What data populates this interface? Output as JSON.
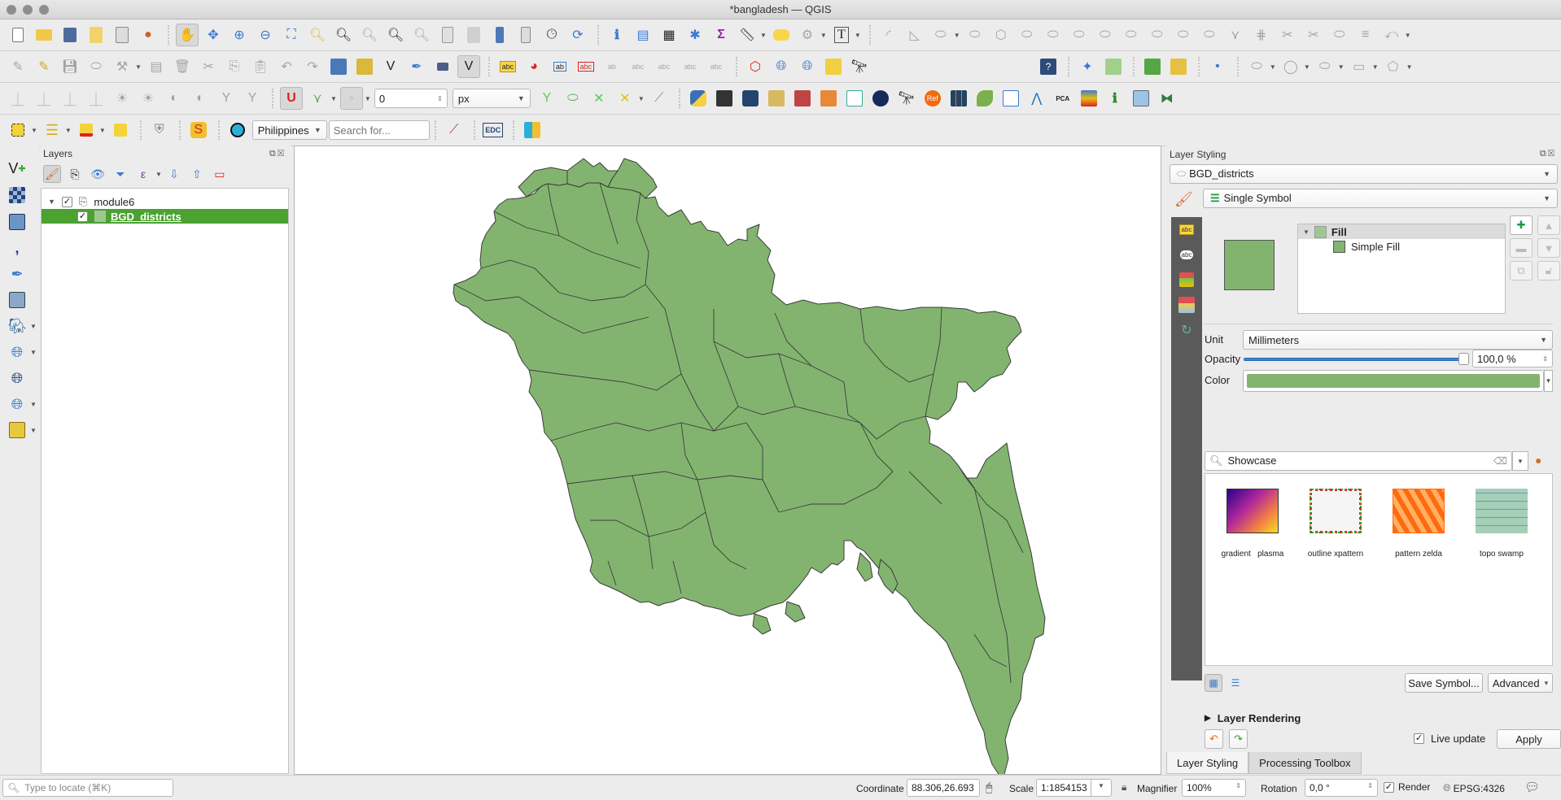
{
  "window": {
    "title": "*bangladesh — QGIS"
  },
  "toolbars": {
    "row1": [
      "new-project",
      "open-project",
      "save-project",
      "new-print-layout",
      "layout-manager",
      "style-manager",
      "pan-map",
      "pan-to-selection",
      "zoom-in",
      "zoom-out",
      "zoom-full",
      "zoom-to-selection",
      "zoom-to-layer",
      "zoom-native",
      "zoom-last",
      "zoom-next",
      "new-bookmark",
      "show-bookmarks",
      "new-spatial-bookmark",
      "temporal-controller",
      "refresh",
      "identify-features",
      "open-attribute-table",
      "open-field-calculator",
      "toolbox",
      "statistical-summary",
      "measure",
      "map-tips",
      "select-by-location",
      "text-annotation"
    ],
    "snapping_tolerance": "0",
    "snapping_unit": "px",
    "locator_country": "Philippines",
    "search_placeholder": "Search for..."
  },
  "layers_panel": {
    "title": "Layers",
    "group": {
      "name": "module6",
      "checked": true,
      "expanded": true
    },
    "layers": [
      {
        "name": "BGD_districts",
        "checked": true,
        "selected": true,
        "swatch_color": "#8cbf7a"
      }
    ]
  },
  "map": {
    "fill_color": "#83b46f",
    "stroke_color": "#3c3c3c",
    "background": "#ffffff"
  },
  "layer_styling": {
    "title": "Layer Styling",
    "layer_select": "BGD_districts",
    "renderer": "Single Symbol",
    "symbol_tree": [
      {
        "label": "Fill",
        "bold": true
      },
      {
        "label": "Simple Fill",
        "bold": false
      }
    ],
    "unit_label": "Unit",
    "unit_value": "Millimeters",
    "opacity_label": "Opacity",
    "opacity_percent": 100,
    "opacity_text": "100,0 %",
    "color_label": "Color",
    "color_value": "#83b46f",
    "search_value": "Showcase",
    "showcase": [
      {
        "label": "gradient   plasma"
      },
      {
        "label": "outline xpattern"
      },
      {
        "label": "pattern zelda"
      },
      {
        "label": "topo swamp"
      }
    ],
    "save_symbol": "Save Symbol...",
    "advanced": "Advanced",
    "layer_rendering": "Layer Rendering",
    "live_update": "Live update",
    "live_update_checked": true,
    "apply": "Apply"
  },
  "dock_tabs": [
    {
      "label": "Layer Styling",
      "active": true
    },
    {
      "label": "Processing Toolbox",
      "active": false
    }
  ],
  "statusbar": {
    "locator_placeholder": "Type to locate (⌘K)",
    "coordinate_label": "Coordinate",
    "coordinate_value": "88.306,26.693",
    "scale_label": "Scale",
    "scale_value": "1:1854153",
    "magnifier_label": "Magnifier",
    "magnifier_value": "100%",
    "rotation_label": "Rotation",
    "rotation_value": "0,0 °",
    "render_label": "Render",
    "render_checked": true,
    "crs": "EPSG:4326"
  }
}
